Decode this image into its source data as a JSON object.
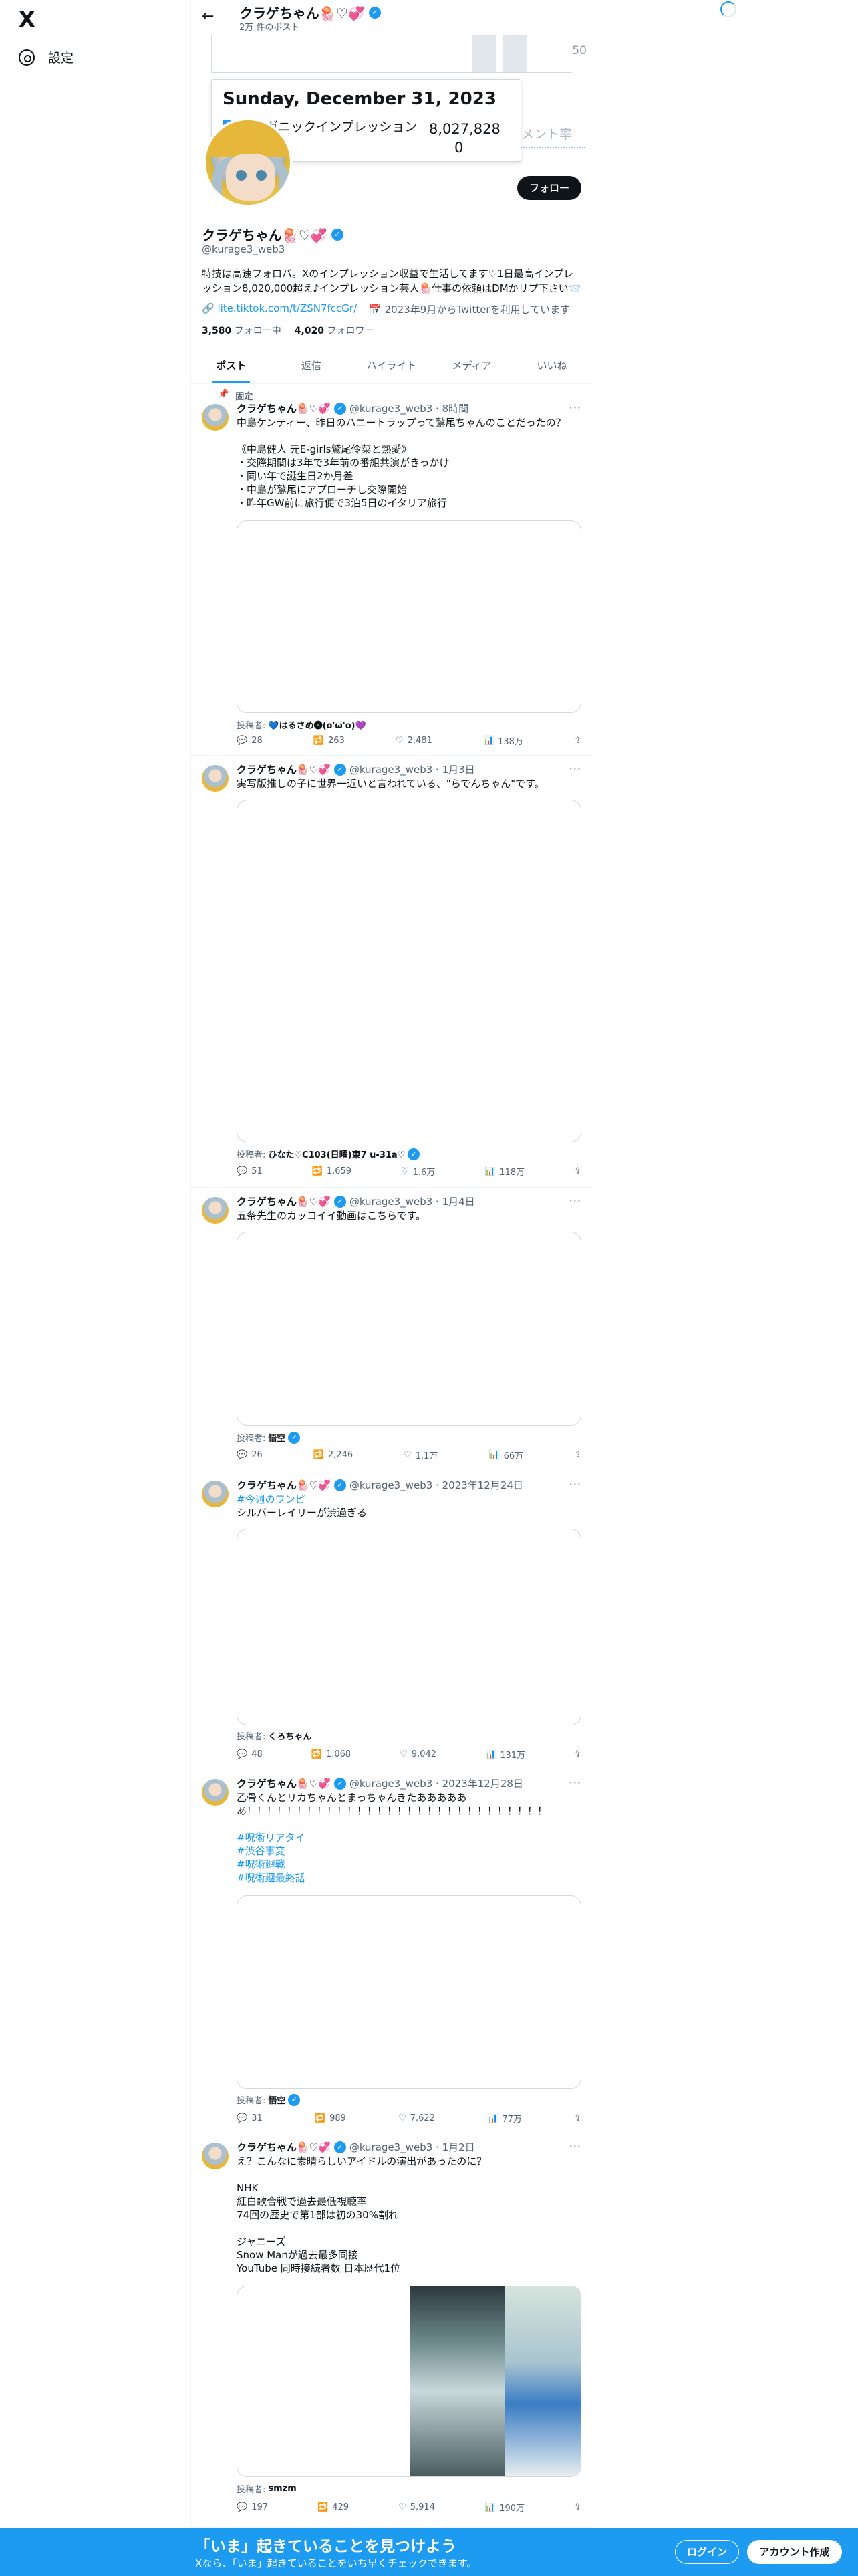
{
  "nav": {
    "settings_label": "設定",
    "logo": "X"
  },
  "topbar": {
    "name": "クラゲちゃん🪼♡💞",
    "post_count": "2万 件のポスト",
    "back_icon": "arrow-left-icon"
  },
  "chart_overlay": {
    "axis_tick": "50",
    "tooltip_date": "Sunday, December 31, 2023",
    "tooltip_series": "オーガニックインプレッション",
    "tooltip_value": "8,027,828",
    "tooltip_value2": "0",
    "ghost_label": "ジメント率"
  },
  "profile": {
    "follow_label": "フォロー",
    "name": "クラゲちゃん🪼♡💞",
    "handle": "@kurage3_web3",
    "bio": "特技は高速フォロバ。Xのインプレッション収益で生活してます♡1日最高インプレッション8,020,000超え♪インプレッション芸人🪼仕事の依頼はDMかリプ下さい📨",
    "link": "lite.tiktok.com/t/ZSN7fccGr/",
    "joined": "2023年9月からTwitterを利用しています",
    "following_count": "3,580",
    "following_label": "フォロー中",
    "followers_count": "4,020",
    "followers_label": "フォロワー"
  },
  "tabs": [
    "ポスト",
    "返信",
    "ハイライト",
    "メディア",
    "いいね"
  ],
  "tweets": [
    {
      "pinned_label": "固定",
      "name": "クラゲちゃん🪼♡💞",
      "handle_time": "@kurage3_web3 · 8時間",
      "text": "中島ケンティー、昨日のハニートラップって鷲尾ちゃんのことだったの？\n\n《中島健人 元E-girls鷲尾伶菜と熱愛》\n・交際期間は3年で3年前の番組共演がきっかけ\n・同い年で誕生日2か月差\n・中島が鷲尾にアプローチし交際開始\n・昨年GW前に旅行便で3泊5日のイタリア旅行",
      "credit_label": "投稿者:",
      "credit_name": "💙はるさめ🅧(o'ω'o)💜",
      "replies": "28",
      "reposts": "263",
      "likes": "2,481",
      "views": "138万"
    },
    {
      "name": "クラゲちゃん🪼♡💞",
      "handle_time": "@kurage3_web3 · 1月3日",
      "text": "実写版推しの子に世界一近いと言われている、\"らでんちゃん\"です。",
      "credit_label": "投稿者:",
      "credit_name": "ひなた♡C103(日曜)東7 u-31a♡",
      "replies": "51",
      "reposts": "1,659",
      "likes": "1.6万",
      "views": "118万"
    },
    {
      "name": "クラゲちゃん🪼♡💞",
      "handle_time": "@kurage3_web3 · 1月4日",
      "text": "五条先生のカッコイイ動画はこちらです。",
      "credit_label": "投稿者:",
      "credit_name": "悟空",
      "replies": "26",
      "reposts": "2,246",
      "likes": "1.1万",
      "views": "66万"
    },
    {
      "name": "クラゲちゃん🪼♡💞",
      "handle_time": "@kurage3_web3 · 2023年12月24日",
      "hashtag": "#今週のワンピ",
      "text": "シルバーレイリーが渋過ぎる",
      "credit_label": "投稿者:",
      "credit_name": "くろちゃん",
      "replies": "48",
      "reposts": "1,068",
      "likes": "9,042",
      "views": "131万"
    },
    {
      "name": "クラゲちゃん🪼♡💞",
      "handle_time": "@kurage3_web3 · 2023年12月28日",
      "text": "乙骨くんとリカちゃんとまっちゃんきたあああああ\nあ！！！！！！！！！！！！！！！！！！！！！！！！！！！！！！",
      "hashtags": [
        "#呪術リアタイ",
        "#渋谷事変",
        "#呪術廻戦",
        "#呪術廻最終話"
      ],
      "credit_label": "投稿者:",
      "credit_name": "悟空",
      "replies": "31",
      "reposts": "989",
      "likes": "7,622",
      "views": "77万"
    },
    {
      "name": "クラゲちゃん🪼♡💞",
      "handle_time": "@kurage3_web3 · 1月2日",
      "text": "え？こんなに素晴らしいアイドルの演出があったのに？\n\nNHK\n紅白歌合戦で過去最低視聴率\n74回の歴史で第1部は初の30%割れ\n\nジャニーズ\nSnow Manが過去最多同接\nYouTube 同時接続者数 日本歴代1位",
      "credit_label": "投稿者:",
      "credit_name": "smzm",
      "replies": "197",
      "reposts": "429",
      "likes": "5,914",
      "views": "190万"
    }
  ],
  "banner": {
    "headline": "「いま」起きていることを見つけよう",
    "sub": "Xなら、「いま」起きていることをいち早くチェックできます。",
    "login": "ログイン",
    "signup": "アカウント作成"
  },
  "colors": {
    "accent": "#1d9bf0",
    "text": "#0f1419",
    "muted": "#536471"
  }
}
